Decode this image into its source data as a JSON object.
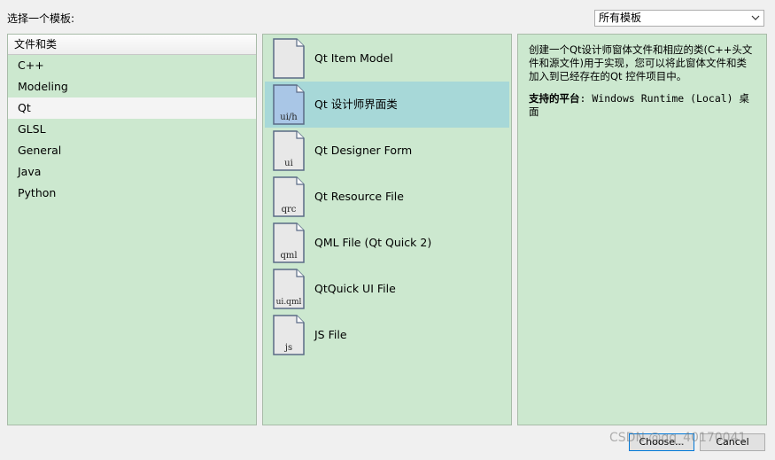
{
  "header": {
    "choose_template_label": "选择一个模板:",
    "filter_value": "所有模板"
  },
  "categories": {
    "header": "文件和类",
    "items": [
      "C++",
      "Modeling",
      "Qt",
      "GLSL",
      "General",
      "Java",
      "Python"
    ],
    "selected": "Qt"
  },
  "templates": [
    {
      "label": "Qt Item Model",
      "icon_text": "",
      "icon": "file-icon",
      "selected": false
    },
    {
      "label": "Qt 设计师界面类",
      "icon_text": "ui/h",
      "icon": "ui-h-file-icon",
      "selected": true
    },
    {
      "label": "Qt Designer Form",
      "icon_text": "ui",
      "icon": "ui-file-icon",
      "selected": false
    },
    {
      "label": "Qt Resource File",
      "icon_text": "qrc",
      "icon": "qrc-file-icon",
      "selected": false
    },
    {
      "label": "QML File (Qt Quick 2)",
      "icon_text": "qml",
      "icon": "qml-file-icon",
      "selected": false
    },
    {
      "label": "QtQuick UI File",
      "icon_text": "ui.qml",
      "icon": "ui-qml-file-icon",
      "selected": false
    },
    {
      "label": "JS File",
      "icon_text": "js",
      "icon": "js-file-icon",
      "selected": false
    }
  ],
  "description": {
    "text": "创建一个Qt设计师窗体文件和相应的类(C++头文件和源文件)用于实现，您可以将此窗体文件和类加入到已经存在的Qt 控件项目中。",
    "platforms_label": "支持的平台",
    "platforms_value": ": Windows Runtime (Local) 桌面"
  },
  "buttons": {
    "choose": "Choose...",
    "cancel": "Cancel"
  },
  "watermark": "CSDN @qq_40170041",
  "colors": {
    "panel_bg": "#cce8cf",
    "selected_bg": "#a7d8d8",
    "window_bg": "#f0f0f0"
  }
}
